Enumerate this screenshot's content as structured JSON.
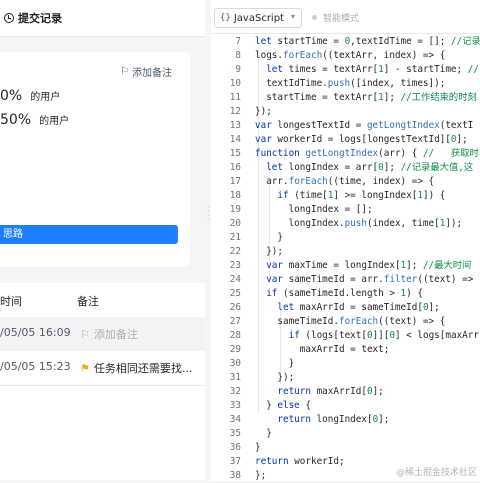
{
  "left_panel": {
    "tab_history_label": "提交记录",
    "card": {
      "add_note_label": "添加备注",
      "stat1_value": "0%",
      "stat1_text": "的用户",
      "stat2_value": "50%",
      "stat2_text": "的用户",
      "idea_button_label": "思路"
    },
    "table": {
      "col_time": "时间",
      "col_note": "备注",
      "rows": [
        {
          "time": "/05/05 16:09",
          "note": "添加备注"
        },
        {
          "time": "/05/05 15:23",
          "note": "任务相同还需要找..."
        }
      ]
    }
  },
  "editor": {
    "language": "JavaScript",
    "smart_mode_label": "智能模式",
    "line_numbers": [
      "7",
      "8",
      "9",
      "10",
      "11",
      "12",
      "13",
      "14",
      "15",
      "16",
      "17",
      "18",
      "19",
      "20",
      "21",
      "22",
      "23",
      "24",
      "25",
      "26",
      "27",
      "28",
      "29",
      "30",
      "31",
      "32",
      "33",
      "34",
      "35",
      "36",
      "37",
      "38"
    ],
    "watermark": "@稀土掘金技术社区"
  },
  "colors": {
    "accent": "#1e80ff",
    "flag_yellow": "#f5a623",
    "keyword": "#0033b3",
    "comment": "#0b8c4a"
  }
}
